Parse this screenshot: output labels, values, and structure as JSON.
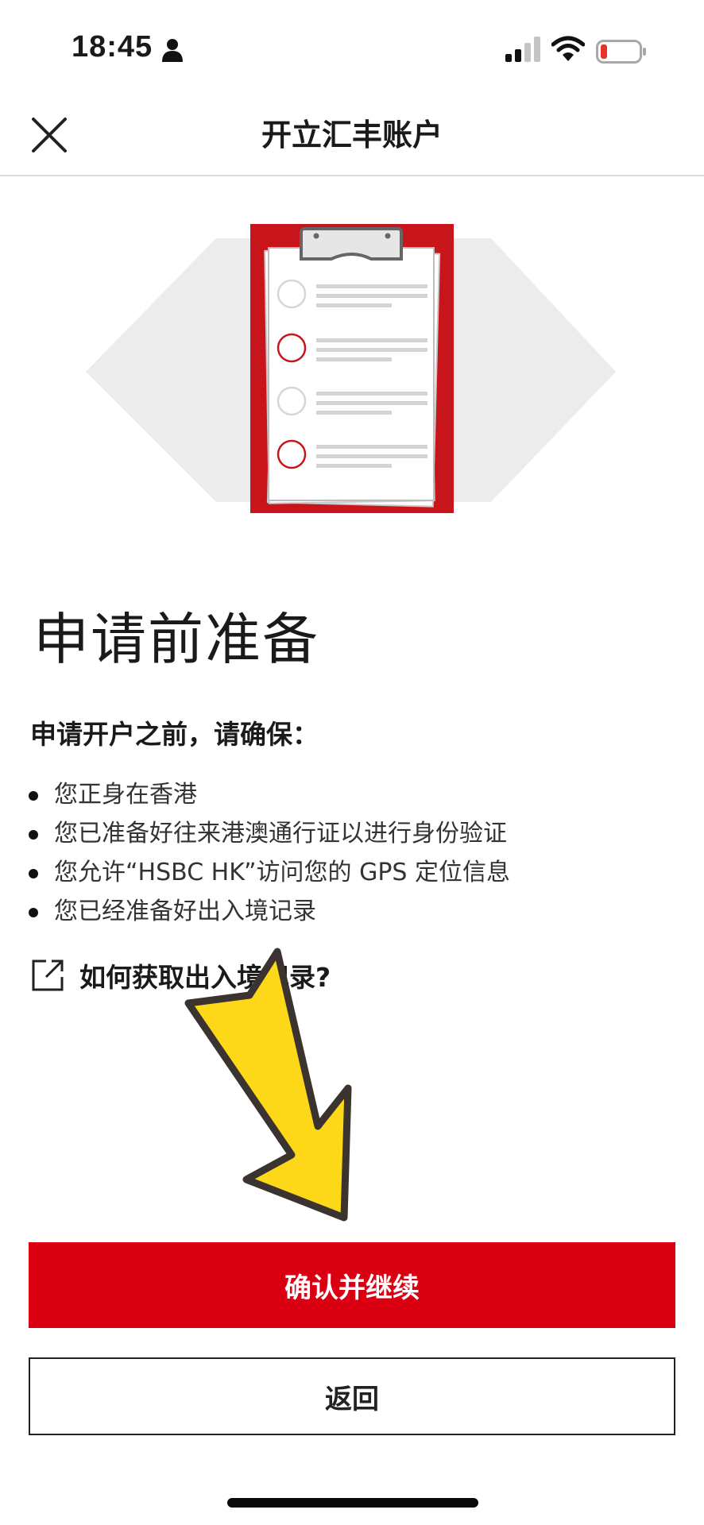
{
  "status_bar": {
    "time": "18:45",
    "icons": [
      "person-icon",
      "signal-icon",
      "wifi-icon",
      "battery-icon"
    ],
    "battery_color": "#e8322c"
  },
  "header": {
    "title": "开立汇丰账户",
    "close_icon": "close-icon"
  },
  "illustration": {
    "icon": "clipboard-checklist-illustration",
    "accent_color": "#c8151b"
  },
  "main": {
    "title": "申请前准备",
    "subtitle": "申请开户之前，请确保：",
    "requirements": [
      {
        "text": "您正身在香港"
      },
      {
        "text": "您已准备好往来港澳通行证以进行身份验证"
      },
      {
        "text": "您允许“HSBC HK”访问您的 GPS 定位信息"
      },
      {
        "text": "您已经准备好出入境记录"
      }
    ],
    "help_link": {
      "icon": "external-link-icon",
      "label": "如何获取出入境记录?"
    }
  },
  "annotation": {
    "icon": "yellow-arrow-icon",
    "color": "#fdd819"
  },
  "actions": {
    "confirm_label": "确认并继续",
    "back_label": "返回",
    "primary_color": "#db0011"
  }
}
